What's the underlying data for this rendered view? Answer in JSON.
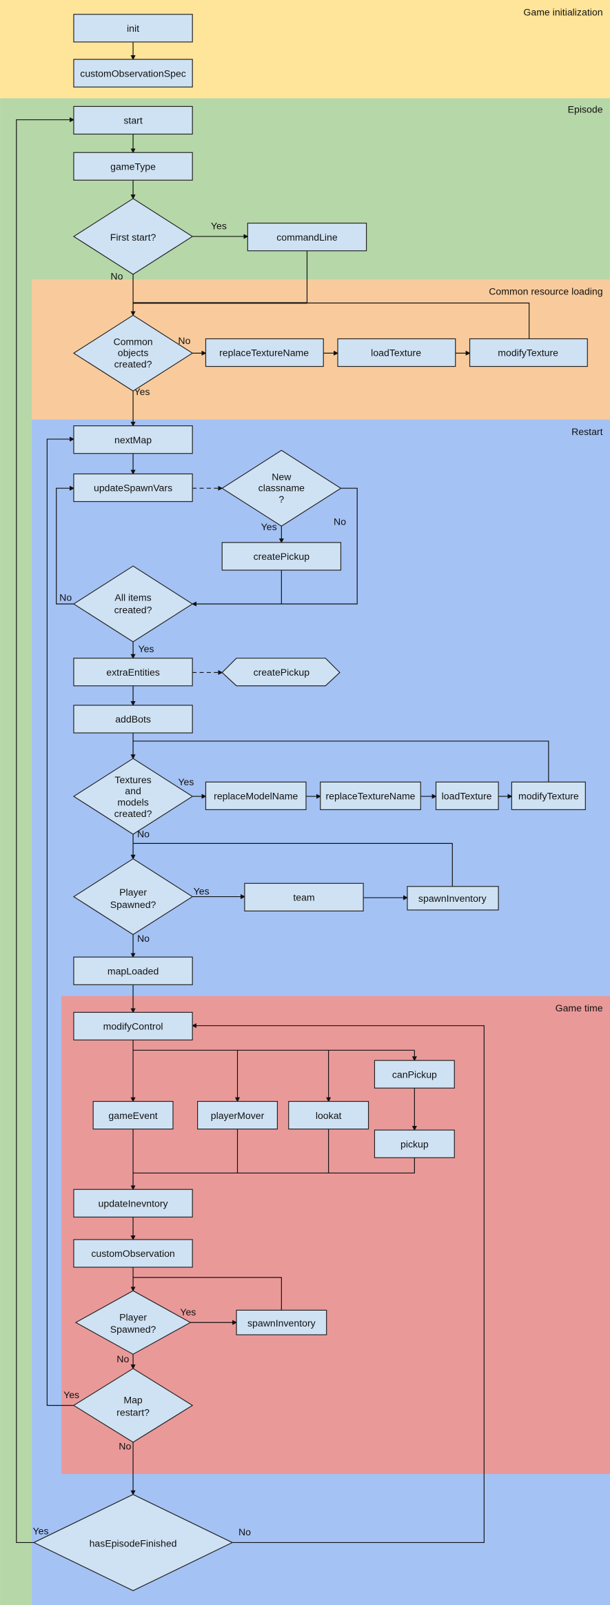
{
  "regions": {
    "init": {
      "title": "Game initialization",
      "color": "#ffe599"
    },
    "episode": {
      "title": "Episode",
      "color": "#b6d7a8"
    },
    "common": {
      "title": "Common resource loading",
      "color": "#f9cb9c"
    },
    "restart": {
      "title": "Restart",
      "color": "#a4c2f4"
    },
    "gametime": {
      "title": "Game time",
      "color": "#ea9999"
    }
  },
  "node_color": "#cfe2f3",
  "nodes": {
    "init": "init",
    "customObservationSpec": "customObservationSpec",
    "start": "start",
    "gameType": "gameType",
    "firstStart": "First start?",
    "commandLine": "commandLine",
    "commonObjects": [
      "Common",
      "objects",
      "created?"
    ],
    "replaceTextureName1": "replaceTextureName",
    "loadTexture1": "loadTexture",
    "modifyTexture1": "modifyTexture",
    "nextMap": "nextMap",
    "updateSpawnVars": "updateSpawnVars",
    "newClassname": [
      "New",
      "classname",
      "?"
    ],
    "createPickup1": "createPickup",
    "allItems": [
      "All items",
      "created?"
    ],
    "extraEntities": "extraEntities",
    "createPickup2": "createPickup",
    "addBots": "addBots",
    "texturesModels": [
      "Textures",
      "and",
      "models",
      "created?"
    ],
    "replaceModelName": "replaceModelName",
    "replaceTextureName2": "replaceTextureName",
    "loadTexture2": "loadTexture",
    "modifyTexture2": "modifyTexture",
    "playerSpawned1": [
      "Player",
      "Spawned?"
    ],
    "team": "team",
    "spawnInventory1": "spawnInventory",
    "mapLoaded": "mapLoaded",
    "modifyControl": "modifyControl",
    "canPickup": "canPickup",
    "gameEvent": "gameEvent",
    "playerMover": "playerMover",
    "lookat": "lookat",
    "pickup": "pickup",
    "updateInevntory": "updateInevntory",
    "customObservation": "customObservation",
    "playerSpawned2": [
      "Player",
      "Spawned?"
    ],
    "spawnInventory2": "spawnInventory",
    "mapRestart": [
      "Map",
      "restart?"
    ],
    "hasEpisodeFinished": "hasEpisodeFinished"
  },
  "labels": {
    "yes": "Yes",
    "no": "No"
  }
}
